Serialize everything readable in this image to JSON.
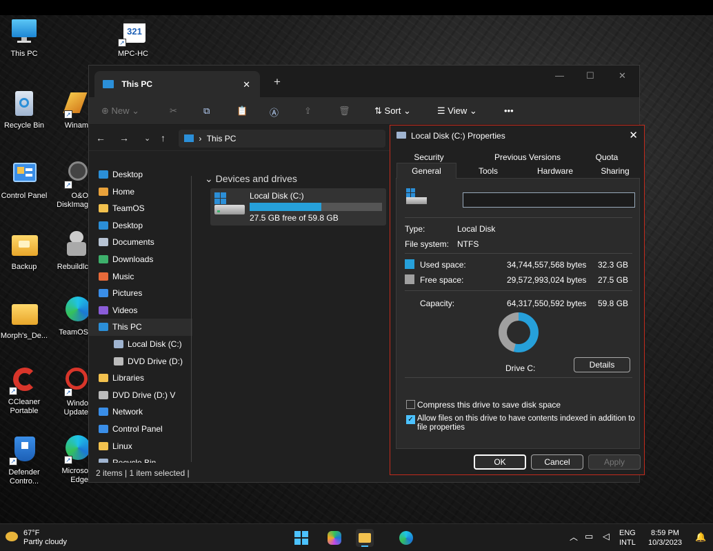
{
  "desktop": {
    "icons": [
      {
        "label": "This PC"
      },
      {
        "label": "MPC-HC"
      },
      {
        "label": "Recycle Bin"
      },
      {
        "label": "Winam"
      },
      {
        "label": "Control Panel"
      },
      {
        "label": "O&O",
        "label2": "DiskImag"
      },
      {
        "label": "Backup"
      },
      {
        "label": "Rebuildlc"
      },
      {
        "label": "Morph's_De..."
      },
      {
        "label": "TeamOS"
      },
      {
        "label": "CCleaner",
        "label2": "Portable"
      },
      {
        "label": "Windo",
        "label2": "Update"
      },
      {
        "label": "Defender",
        "label2": "Contro..."
      },
      {
        "label": "Microso",
        "label2": "Edge"
      }
    ],
    "mpc_badge": "321"
  },
  "explorer": {
    "tab_title": "This PC",
    "tab_close": "✕",
    "new_tab": "+",
    "toolbar": {
      "new_label": "New",
      "sort_label": "Sort",
      "view_label": "View",
      "more_label": "•••"
    },
    "address": {
      "separator": "›",
      "location": "This PC"
    },
    "sidebar": [
      {
        "label": "Desktop",
        "color": "#2b8fd8"
      },
      {
        "label": "Home",
        "color": "#e9a23b"
      },
      {
        "label": "TeamOS",
        "color": "#f2c14e"
      },
      {
        "label": "Desktop",
        "color": "#2b8fd8"
      },
      {
        "label": "Documents",
        "color": "#b8c4d4"
      },
      {
        "label": "Downloads",
        "color": "#3db06b"
      },
      {
        "label": "Music",
        "color": "#e86a3a"
      },
      {
        "label": "Pictures",
        "color": "#3a8ee8"
      },
      {
        "label": "Videos",
        "color": "#8a5cd8"
      },
      {
        "label": "This PC",
        "color": "#2b8fd8"
      },
      {
        "label": "Local Disk (C:)",
        "color": "#9fb4d0"
      },
      {
        "label": "DVD Drive (D:)",
        "color": "#bbbbbb"
      },
      {
        "label": "Libraries",
        "color": "#f2c14e"
      },
      {
        "label": "DVD Drive (D:) V",
        "color": "#bbbbbb"
      },
      {
        "label": "Network",
        "color": "#3a8ee8"
      },
      {
        "label": "Control Panel",
        "color": "#3a8ee8"
      },
      {
        "label": "Linux",
        "color": "#f2c14e"
      },
      {
        "label": "Recycle Bin",
        "color": "#9fb4d0"
      }
    ],
    "section_title": "Devices and drives",
    "drive": {
      "name": "Local Disk (C:)",
      "free_text": "27.5 GB free of 59.8 GB",
      "used_fraction": 0.54
    },
    "status": "2 items  |  1 item selected  |"
  },
  "dialog": {
    "title": "Local Disk (C:) Properties",
    "tabs_top": [
      "Security",
      "Previous Versions",
      "Quota"
    ],
    "tabs_bottom": [
      "General",
      "Tools",
      "Hardware",
      "Sharing"
    ],
    "name_value": "",
    "type_label": "Type:",
    "type_value": "Local Disk",
    "fs_label": "File system:",
    "fs_value": "NTFS",
    "used_label": "Used space:",
    "used_bytes": "34,744,557,568 bytes",
    "used_gb": "32.3 GB",
    "free_label": "Free space:",
    "free_bytes": "29,572,993,024 bytes",
    "free_gb": "27.5 GB",
    "cap_label": "Capacity:",
    "cap_bytes": "64,317,550,592 bytes",
    "cap_gb": "59.8 GB",
    "used_color": "#26a0da",
    "free_color": "#a0a0a0",
    "drive_label": "Drive C:",
    "details_button": "Details",
    "compress_label": "Compress this drive to save disk space",
    "compress_checked": false,
    "index_label": "Allow files on this drive to have contents indexed in addition to",
    "index_label2": "file properties",
    "index_checked": true,
    "ok": "OK",
    "cancel": "Cancel",
    "apply": "Apply"
  },
  "taskbar": {
    "temp": "67°F",
    "weather": "Partly cloudy",
    "lang1": "ENG",
    "lang2": "INTL",
    "time": "8:59 PM",
    "date": "10/3/2023"
  }
}
